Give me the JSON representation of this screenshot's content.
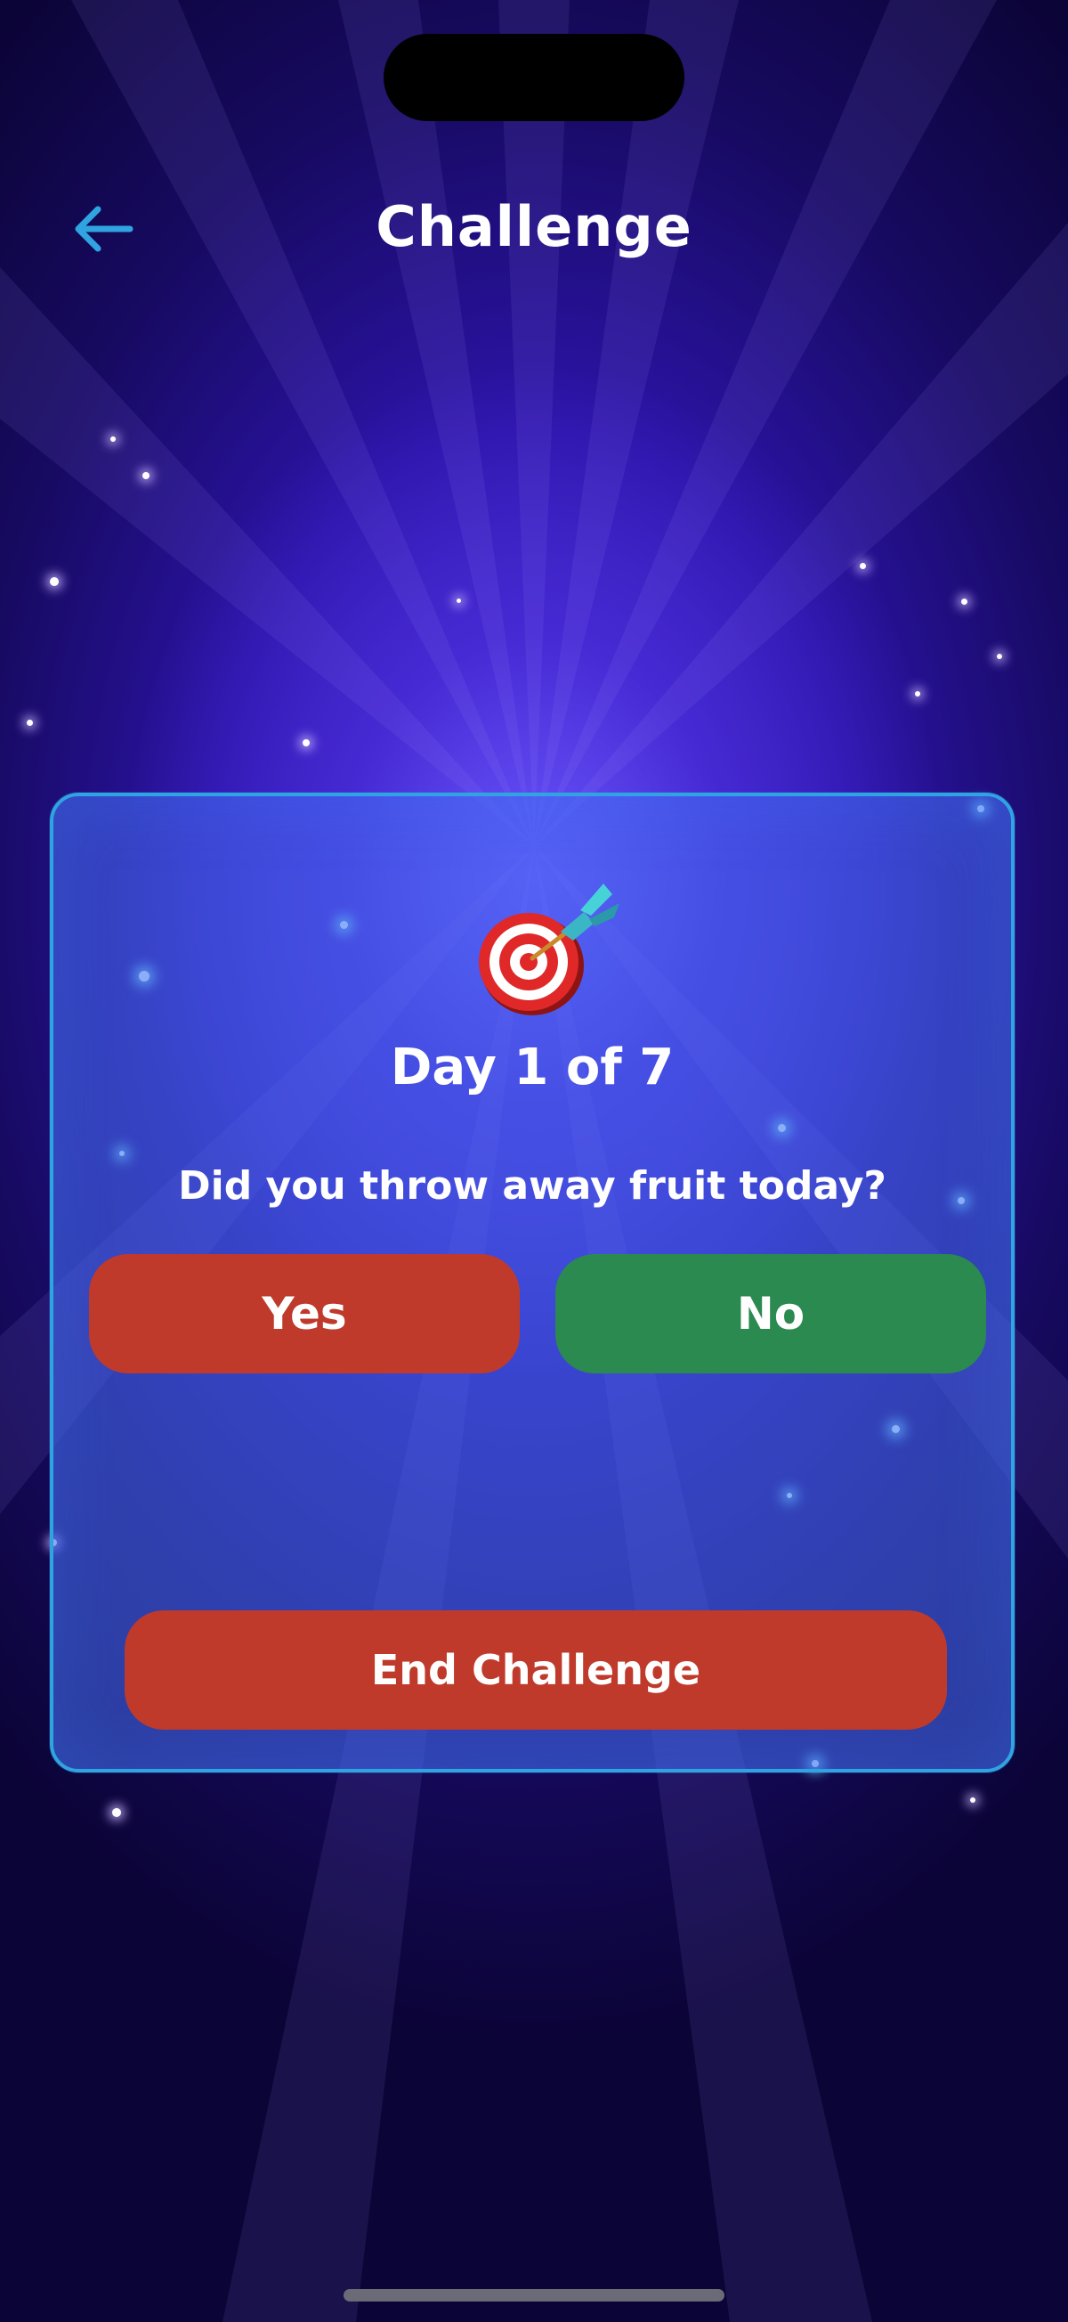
{
  "header": {
    "title": "Challenge",
    "back_icon": "arrow-left-icon",
    "accent_color": "#2fa4e0"
  },
  "card": {
    "icon": "target-dart-icon",
    "day_label": "Day 1 of 7",
    "question": "Did you throw away fruit today?",
    "yes_label": "Yes",
    "no_label": "No",
    "end_label": "End Challenge",
    "colors": {
      "yes": "#bf3a2b",
      "no": "#2a8a50",
      "end": "#bf3a2b",
      "border": "#2fa4e0"
    }
  }
}
